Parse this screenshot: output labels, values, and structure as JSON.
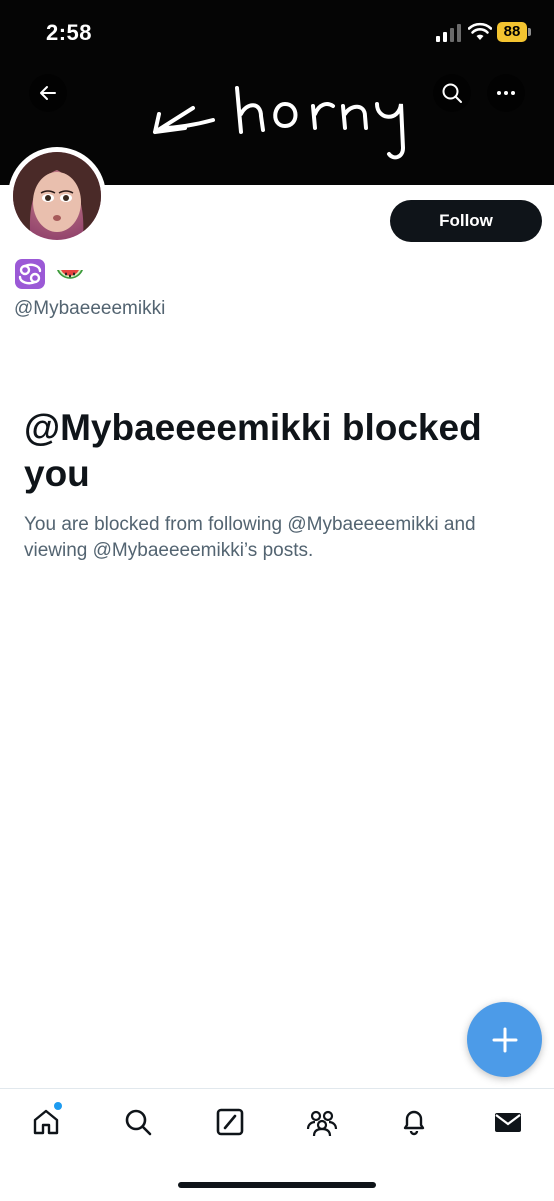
{
  "status_bar": {
    "time": "2:58",
    "battery": "88"
  },
  "header": {
    "banner_scribble_text": "horny"
  },
  "profile": {
    "handle": "@Mybaeeeemikki",
    "bio_emojis": [
      "cancer-zodiac-icon",
      "watermelon-icon"
    ],
    "follow_label": "Follow"
  },
  "blocked": {
    "title": "@Mybaeeeemikki blocked you",
    "description": "You are blocked from following @Mybaeeeemikki and viewing @Mybaeeeemikki’s posts."
  },
  "bottom_nav": {
    "items": [
      "home-icon",
      "search-icon",
      "grok-icon",
      "communities-icon",
      "notifications-icon",
      "messages-icon"
    ]
  },
  "colors": {
    "accent": "#1d9bf0",
    "fab": "#4c9be8",
    "text_primary": "#0f1419",
    "text_secondary": "#536471",
    "battery": "#f4c430"
  }
}
